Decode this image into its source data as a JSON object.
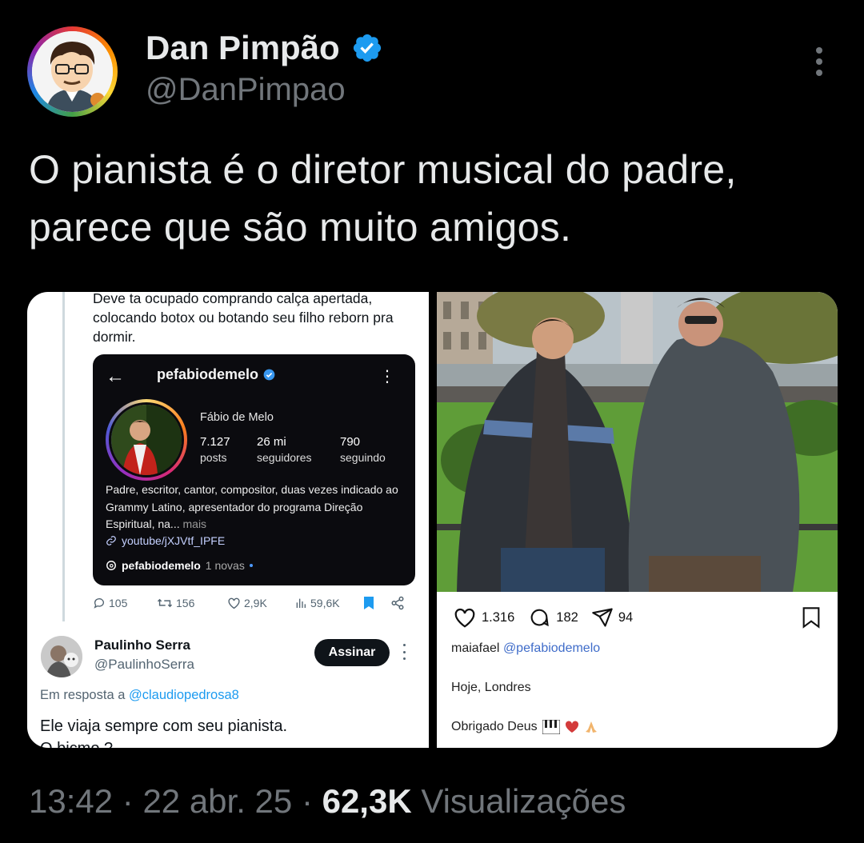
{
  "author": {
    "display_name": "Dan Pimpão",
    "handle": "@DanPimpao",
    "verified": true
  },
  "tweet": {
    "text": "O pianista é o diretor musical do padre, parece que são muito amigos."
  },
  "left_screenshot": {
    "clipped_text": "Deve ta ocupado comprando calça apertada, colocando botox ou botando seu filho reborn pra dormir.",
    "instagram_card": {
      "username": "pefabiodemelo",
      "full_name": "Fábio de Melo",
      "stats": [
        {
          "value": "7.127",
          "label": "posts"
        },
        {
          "value": "26 mi",
          "label": "seguidores"
        },
        {
          "value": "790",
          "label": "seguindo"
        }
      ],
      "bio": "Padre, escritor, cantor, compositor, duas vezes indicado ao Grammy Latino, apresentador do programa Direção Espiritual, na...",
      "bio_more": "mais",
      "link": "youtube/jXJVtf_IPFE",
      "threads_user": "pefabiodemelo",
      "threads_new": "1 novas"
    },
    "actions": {
      "replies": "105",
      "reposts": "156",
      "likes": "2,9K",
      "views": "59,6K"
    },
    "reply": {
      "name": "Paulinho Serra",
      "handle": "@PaulinhoSerra",
      "subscribe_label": "Assinar",
      "in_reply_prefix": "Em resposta a",
      "in_reply_mention": "@claudiopedrosa8",
      "text": "Ele viaja sempre com seu pianista.",
      "text_cut": "O bicmo ?"
    }
  },
  "right_screenshot": {
    "likes": "1.316",
    "comments": "182",
    "shares": "94",
    "caption_user": "maiafael",
    "caption_tag": "@pefabiodemelo",
    "caption_line1": "Hoje, Londres",
    "caption_line2": "Obrigado Deus"
  },
  "footer": {
    "time": "13:42",
    "date": "22 abr. 25",
    "views": "62,3K",
    "views_label": "Visualizações"
  },
  "colors": {
    "background": "#000000",
    "verified_blue": "#1d9bf0",
    "secondary_text": "#71767b",
    "primary_text": "#e7e9ea"
  }
}
